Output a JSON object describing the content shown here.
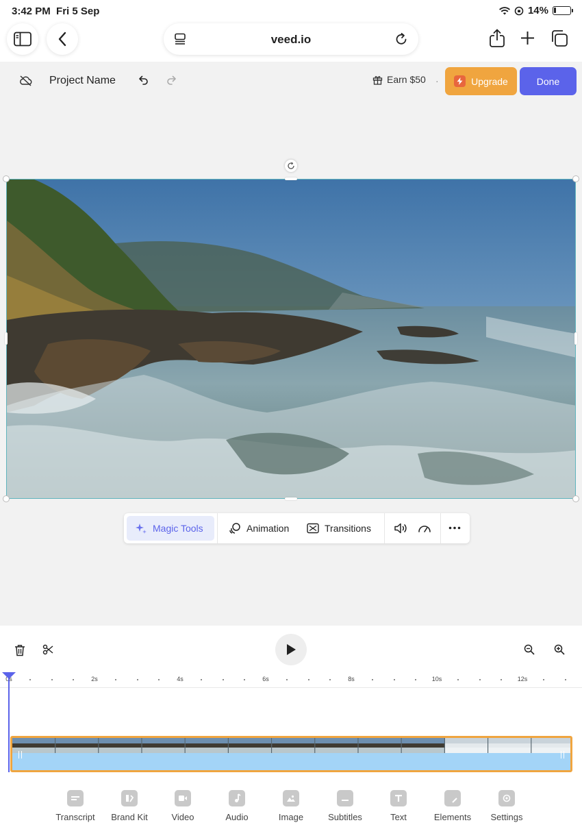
{
  "status_bar": {
    "time": "3:42 PM",
    "date": "Fri 5 Sep",
    "battery": "14%",
    "battery_level": 0.14
  },
  "browser": {
    "url": "veed.io"
  },
  "editor": {
    "project_name": "Project Name",
    "earn_label": "Earn $50",
    "separator": "·",
    "upgrade_label": "Upgrade",
    "done_label": "Done",
    "accent": "#5b63ea",
    "upgrade_color": "#f0a53f"
  },
  "toolbar": {
    "magic_tools": "Magic Tools",
    "animation": "Animation",
    "transitions": "Transitions"
  },
  "timeline": {
    "ruler_labels": [
      "0s",
      "2s",
      "4s",
      "6s",
      "8s",
      "10s",
      "12s"
    ],
    "track_color": "#a6d6f6",
    "track_border": "#f0a53f"
  },
  "bottom_nav": {
    "items": [
      {
        "label": "Transcript",
        "icon": "transcript-icon"
      },
      {
        "label": "Brand Kit",
        "icon": "brand-kit-icon"
      },
      {
        "label": "Video",
        "icon": "video-icon"
      },
      {
        "label": "Audio",
        "icon": "audio-icon"
      },
      {
        "label": "Image",
        "icon": "image-icon"
      },
      {
        "label": "Subtitles",
        "icon": "subtitles-icon"
      },
      {
        "label": "Text",
        "icon": "text-icon"
      },
      {
        "label": "Elements",
        "icon": "elements-icon"
      },
      {
        "label": "Settings",
        "icon": "settings-icon"
      }
    ]
  }
}
